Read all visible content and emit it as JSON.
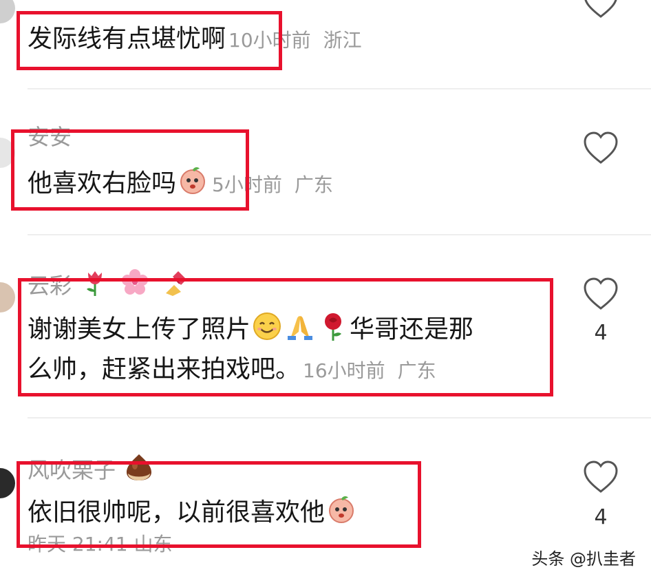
{
  "comments": [
    {
      "username": "",
      "text": "发际线有点堪忧啊",
      "time": "10小时前",
      "location": "浙江",
      "likes": ""
    },
    {
      "username": "安安",
      "text": "他喜欢右脸吗",
      "time": "5小时前",
      "location": "广东",
      "likes": ""
    },
    {
      "username": "云彩",
      "text_line1": "谢谢美女上传了照片",
      "text_line1b": "华哥还是那",
      "text_line2": "么帅，赶紧出来拍戏吧。",
      "time": "16小时前",
      "location": "广东",
      "likes": "4"
    },
    {
      "username": "风吹栗子",
      "text": "依旧很帅呢，以前很喜欢他",
      "time": "昨天 21:41",
      "location": "山东",
      "likes": "4"
    }
  ],
  "watermark": "头条 @扒圭者",
  "colors": {
    "highlight_border": "#e8112d",
    "meta_text": "#9a9a9a",
    "divider": "#eeeeee"
  },
  "icons": {
    "like": "heart-outline-icon",
    "peach_emoji": "peach-emoji-icon",
    "smile_emoji": "smile-emoji-icon",
    "pray_emoji": "pray-emoji-icon",
    "rose_emoji": "rose-emoji-icon",
    "tulip_emoji": "tulip-emoji-icon",
    "blossom_emoji": "blossom-emoji-icon",
    "nail_emoji": "nail-polish-emoji-icon",
    "chestnut_emoji": "chestnut-emoji-icon"
  }
}
